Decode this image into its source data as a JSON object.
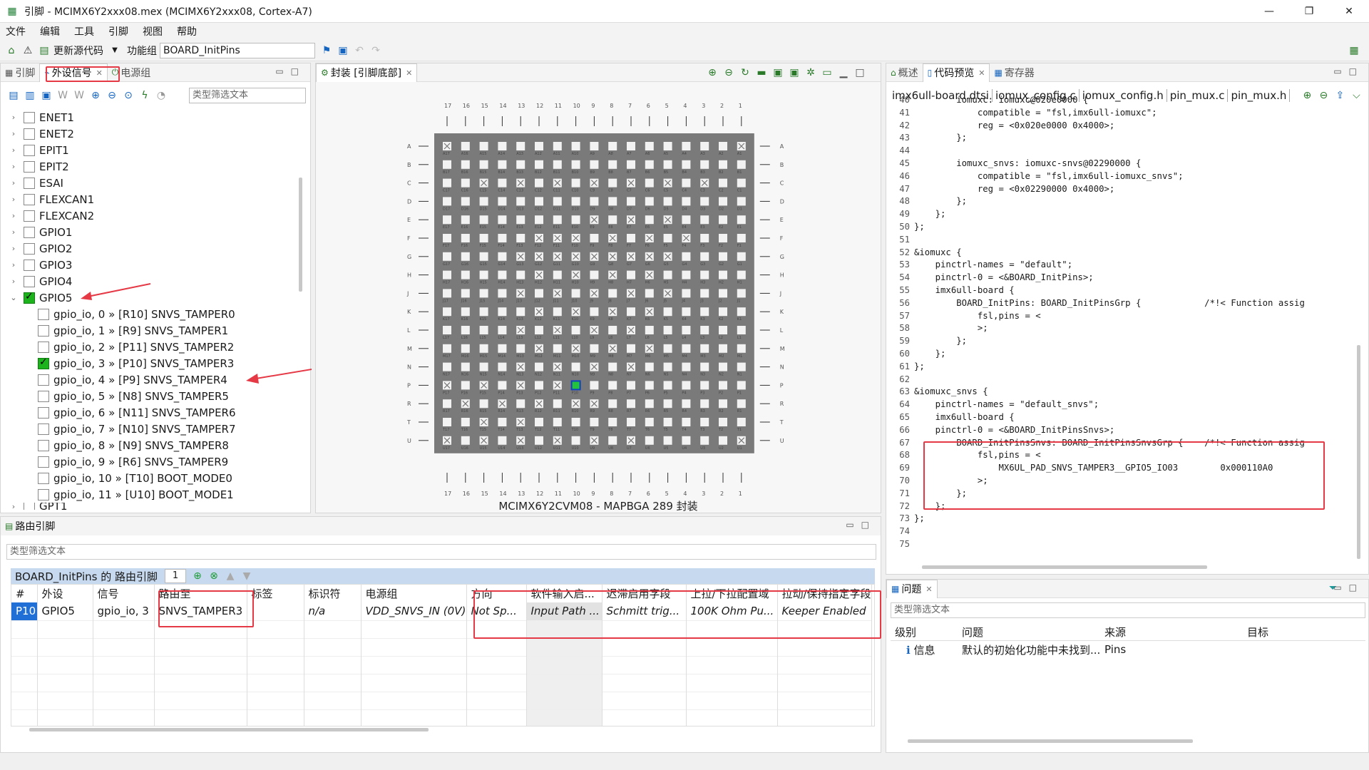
{
  "window": {
    "title": "引脚 - MCIMX6Y2xxx08.mex (MCIMX6Y2xxx08, Cortex-A7)",
    "controls": [
      "—",
      "❐",
      "✕"
    ]
  },
  "menu": [
    "文件",
    "编辑",
    "工具",
    "引脚",
    "视图",
    "帮助"
  ],
  "toolbar": {
    "update_code": "更新源代码",
    "function_group_label": "功能组",
    "function_group_value": "BOARD_InitPins"
  },
  "left_panel": {
    "tabs": [
      "引脚",
      "外设信号",
      "电源组"
    ],
    "filter_placeholder": "类型筛选文本",
    "peripherals": [
      "ENET1",
      "ENET2",
      "EPIT1",
      "EPIT2",
      "ESAI",
      "FLEXCAN1",
      "FLEXCAN2",
      "GPIO1",
      "GPIO2",
      "GPIO3",
      "GPIO4",
      "GPIO5"
    ],
    "gpio5_signals": [
      {
        "label": "gpio_io, 0 » [R10] SNVS_TAMPER0",
        "checked": false
      },
      {
        "label": "gpio_io, 1 » [R9] SNVS_TAMPER1",
        "checked": false
      },
      {
        "label": "gpio_io, 2 » [P11] SNVS_TAMPER2",
        "checked": false
      },
      {
        "label": "gpio_io, 3 » [P10] SNVS_TAMPER3",
        "checked": true
      },
      {
        "label": "gpio_io, 4 » [P9] SNVS_TAMPER4",
        "checked": false
      },
      {
        "label": "gpio_io, 5 » [N8] SNVS_TAMPER5",
        "checked": false
      },
      {
        "label": "gpio_io, 6 » [N11] SNVS_TAMPER6",
        "checked": false
      },
      {
        "label": "gpio_io, 7 » [N10] SNVS_TAMPER7",
        "checked": false
      },
      {
        "label": "gpio_io, 8 » [N9] SNVS_TAMPER8",
        "checked": false
      },
      {
        "label": "gpio_io, 9 » [R6] SNVS_TAMPER9",
        "checked": false
      },
      {
        "label": "gpio_io, 10 » [T10] BOOT_MODE0",
        "checked": false
      },
      {
        "label": "gpio_io, 11 » [U10] BOOT_MODE1",
        "checked": false
      }
    ],
    "cut_off_item": "GPT1"
  },
  "package_panel": {
    "tab": "封装 [引脚底部]",
    "caption": "MCIMX6Y2CVM08 - MAPBGA 289 封装",
    "columns": [
      "17",
      "16",
      "15",
      "14",
      "13",
      "12",
      "11",
      "10",
      "9",
      "8",
      "7",
      "6",
      "5",
      "4",
      "3",
      "2",
      "1"
    ],
    "rows": [
      "A",
      "B",
      "C",
      "D",
      "E",
      "F",
      "G",
      "H",
      "J",
      "K",
      "L",
      "M",
      "N",
      "P",
      "R",
      "T",
      "U"
    ],
    "selected_pin": "P10"
  },
  "right_panel": {
    "tabs": [
      "概述",
      "代码预览",
      "寄存器"
    ],
    "files": [
      "imx6ull-board.dtsi",
      "iomux_config.c",
      "iomux_config.h",
      "pin_mux.c",
      "pin_mux.h"
    ],
    "code": [
      {
        "n": "40",
        "t": "        iomuxc: iomuxc@020e0000 {"
      },
      {
        "n": "41",
        "t": "            compatible = \"fsl,imx6ull-iomuxc\";"
      },
      {
        "n": "42",
        "t": "            reg = <0x020e0000 0x4000>;"
      },
      {
        "n": "43",
        "t": "        };"
      },
      {
        "n": "44",
        "t": ""
      },
      {
        "n": "45",
        "t": "        iomuxc_snvs: iomuxc-snvs@02290000 {"
      },
      {
        "n": "46",
        "t": "            compatible = \"fsl,imx6ull-iomuxc_snvs\";"
      },
      {
        "n": "47",
        "t": "            reg = <0x02290000 0x4000>;"
      },
      {
        "n": "48",
        "t": "        };"
      },
      {
        "n": "49",
        "t": "    };"
      },
      {
        "n": "50",
        "t": "};"
      },
      {
        "n": "51",
        "t": ""
      },
      {
        "n": "52",
        "t": "&iomuxc {"
      },
      {
        "n": "53",
        "t": "    pinctrl-names = \"default\";"
      },
      {
        "n": "54",
        "t": "    pinctrl-0 = <&BOARD_InitPins>;"
      },
      {
        "n": "55",
        "t": "    imx6ull-board {"
      },
      {
        "n": "56",
        "t": "        BOARD_InitPins: BOARD_InitPinsGrp {            /*!< Function assig"
      },
      {
        "n": "57",
        "t": "            fsl,pins = <"
      },
      {
        "n": "58",
        "t": "            >;"
      },
      {
        "n": "59",
        "t": "        };"
      },
      {
        "n": "60",
        "t": "    };"
      },
      {
        "n": "61",
        "t": "};"
      },
      {
        "n": "62",
        "t": ""
      },
      {
        "n": "63",
        "t": "&iomuxc_snvs {"
      },
      {
        "n": "64",
        "t": "    pinctrl-names = \"default_snvs\";"
      },
      {
        "n": "65",
        "t": "    imx6ull-board {"
      },
      {
        "n": "66",
        "t": "    pinctrl-0 = <&BOARD_InitPinsSnvs>;"
      },
      {
        "n": "67",
        "t": "        BOARD_InitPinsSnvs: BOARD_InitPinsSnvsGrp {    /*!< Function assig"
      },
      {
        "n": "68",
        "t": "            fsl,pins = <"
      },
      {
        "n": "69",
        "t": "                MX6UL_PAD_SNVS_TAMPER3__GPIO5_IO03        0x000110A0"
      },
      {
        "n": "70",
        "t": "            >;"
      },
      {
        "n": "71",
        "t": "        };"
      },
      {
        "n": "72",
        "t": "    };"
      },
      {
        "n": "73",
        "t": "};"
      },
      {
        "n": "74",
        "t": ""
      },
      {
        "n": "75",
        "t": ""
      }
    ]
  },
  "routing_panel": {
    "title": "路由引脚",
    "filter_placeholder": "类型筛选文本",
    "table_title": "BOARD_InitPins 的 路由引脚",
    "count": "1",
    "headers": [
      "#",
      "外设",
      "信号",
      "路由至",
      "标签",
      "标识符",
      "电源组",
      "方向",
      "软件输入启...",
      "迟滞启用字段",
      "上拉/下拉配置域",
      "拉动/保持指定字段"
    ],
    "row": [
      "P10",
      "GPIO5",
      "gpio_io, 3",
      "SNVS_TAMPER3",
      "",
      "n/a",
      "VDD_SNVS_IN (0V)",
      "Not Sp...",
      "Input Path ...",
      "Schmitt trig...",
      "100K Ohm Pu...",
      "Keeper Enabled"
    ]
  },
  "problems_panel": {
    "title": "问题",
    "filter_placeholder": "类型筛选文本",
    "headers": [
      "级别",
      "问题",
      "来源",
      "目标"
    ],
    "row": [
      "信息",
      "默认的初始化功能中未找到...",
      "Pins",
      ""
    ]
  },
  "colors": {
    "highlight": "#e53946",
    "check_green": "#1db31d",
    "pin_selected": "#22c23e",
    "chip_body": "#7a7a7a",
    "row_select": "#1f6fd6"
  }
}
